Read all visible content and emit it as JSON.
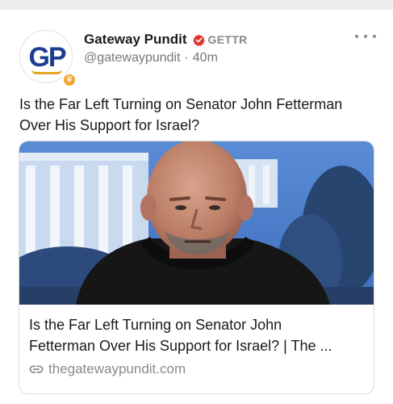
{
  "post": {
    "author_name": "Gateway Pundit",
    "platform": "GETTR",
    "handle": "@gatewaypundit",
    "separator": "·",
    "time": "40m",
    "avatar_initials": "GP",
    "text": "Is the Far Left Turning on Senator John Fetterman Over His Support for Israel?"
  },
  "link_card": {
    "title": "Is the Far Left Turning on Senator John\nFetterman Over His Support for Israel? | The ...",
    "domain": "thegatewaypundit.com"
  },
  "colors": {
    "verified": "#e3342f",
    "avatar_text": "#1d3d8f",
    "avatar_badge": "#f4a531",
    "muted_text": "#777777"
  },
  "icons": [
    "verified-badge-icon",
    "more-options-icon",
    "link-icon"
  ]
}
